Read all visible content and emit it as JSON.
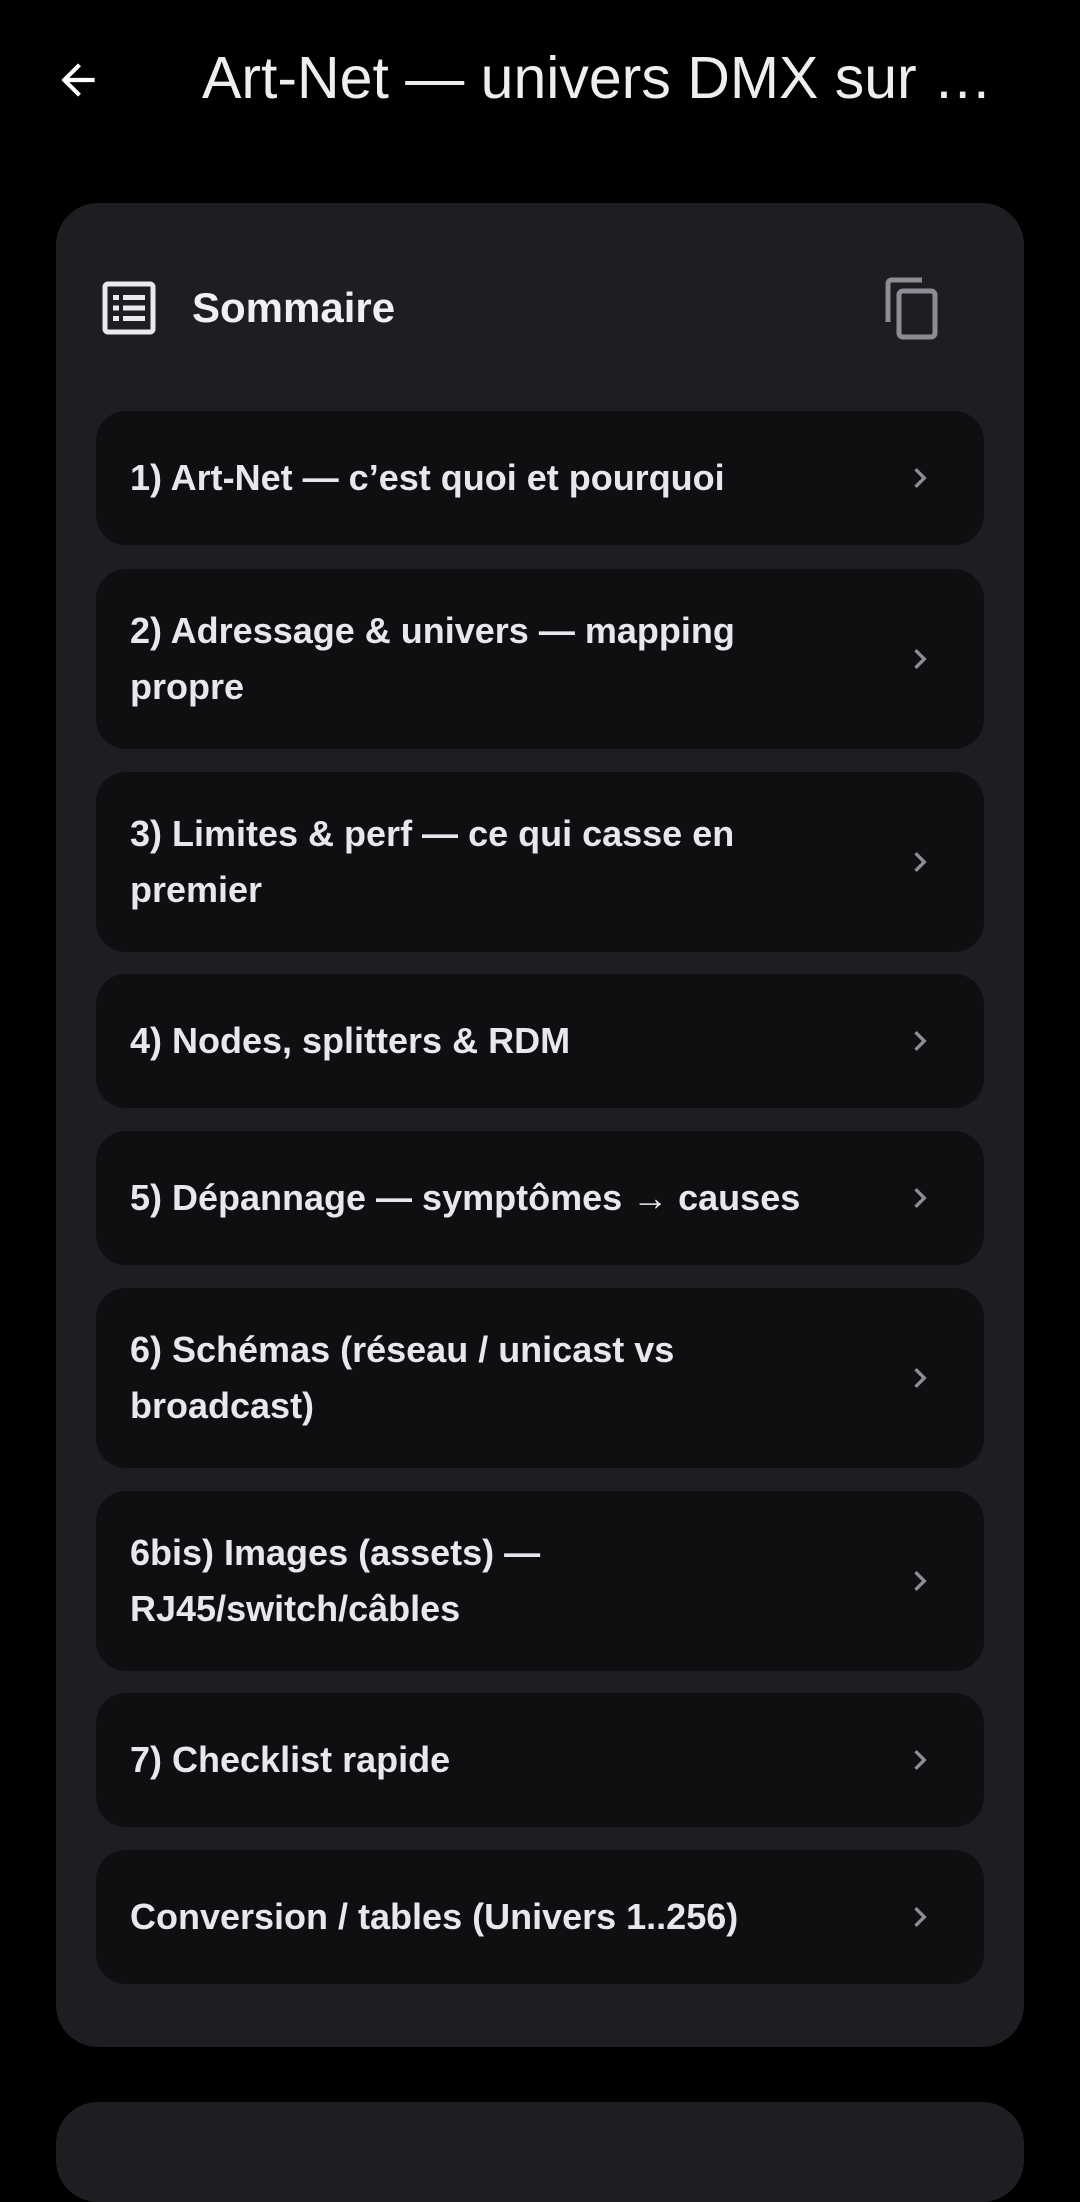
{
  "app_bar": {
    "title": "Art-Net — univers DMX sur l…",
    "back_icon": "arrow-back-icon"
  },
  "colors": {
    "background": "#000000",
    "card": "#1e1d22",
    "item": "#0f0e10",
    "text": "#e9e6ec",
    "icon": "#8e8c94"
  },
  "toc": {
    "title": "Sommaire",
    "header_icon": "list-icon",
    "copy_icon": "copy-icon",
    "items": [
      {
        "label": "1) Art-Net — c’est quoi et pourquoi"
      },
      {
        "label": "2) Adressage & univers — mapping propre"
      },
      {
        "label": "3) Limites & perf — ce qui casse en premier"
      },
      {
        "label": "4) Nodes, splitters & RDM"
      },
      {
        "label": "5) Dépannage — symptômes → causes"
      },
      {
        "label": "6) Schémas (réseau / unicast vs broadcast)"
      },
      {
        "label": "6bis) Images (assets) — RJ45/switch/câbles"
      },
      {
        "label": "7) Checklist rapide"
      },
      {
        "label": "Conversion / tables (Univers 1..256)"
      }
    ]
  }
}
